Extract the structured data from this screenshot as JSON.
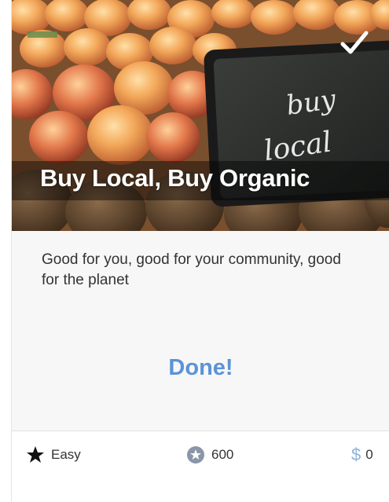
{
  "card": {
    "title": "Buy Local, Buy Organic",
    "description": "Good for you, good for your community, good for the planet",
    "status": "Done!",
    "completed_icon": "checkmark-icon",
    "sign_text": "buy local"
  },
  "stats": {
    "difficulty": {
      "icon": "star-icon",
      "label": "Easy"
    },
    "points": {
      "icon": "badge-star-icon",
      "value": "600"
    },
    "cost": {
      "icon": "dollar-icon",
      "symbol": "$",
      "value": "0"
    }
  },
  "colors": {
    "accent": "#5b93d7",
    "dollar": "#8fb3d9",
    "badge": "#8a96a8"
  }
}
